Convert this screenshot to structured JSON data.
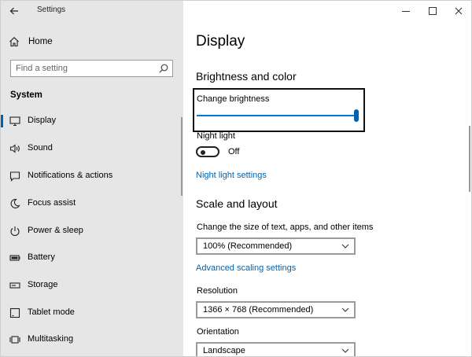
{
  "window": {
    "title": "Settings",
    "back_icon": "back-arrow-icon",
    "controls": [
      "minimize-icon",
      "maximize-icon",
      "close-icon"
    ]
  },
  "sidebar": {
    "home_label": "Home",
    "search_placeholder": "Find a setting",
    "section_label": "System",
    "items": [
      {
        "label": "Display",
        "icon": "display-icon",
        "selected": true
      },
      {
        "label": "Sound",
        "icon": "sound-icon",
        "selected": false
      },
      {
        "label": "Notifications & actions",
        "icon": "notifications-icon",
        "selected": false
      },
      {
        "label": "Focus assist",
        "icon": "moon-icon",
        "selected": false
      },
      {
        "label": "Power & sleep",
        "icon": "power-icon",
        "selected": false
      },
      {
        "label": "Battery",
        "icon": "battery-icon",
        "selected": false
      },
      {
        "label": "Storage",
        "icon": "storage-icon",
        "selected": false
      },
      {
        "label": "Tablet mode",
        "icon": "tablet-icon",
        "selected": false
      },
      {
        "label": "Multitasking",
        "icon": "multitasking-icon",
        "selected": false
      }
    ]
  },
  "content": {
    "page_title": "Display",
    "brightness_section": {
      "heading": "Brightness and color",
      "brightness_label": "Change brightness",
      "brightness_value": 1.0,
      "night_light_label": "Night light",
      "night_light_state": "Off",
      "night_light_link": "Night light settings"
    },
    "scale_section": {
      "heading": "Scale and layout",
      "size_label": "Change the size of text, apps, and other items",
      "size_value": "100% (Recommended)",
      "advanced_link": "Advanced scaling settings",
      "resolution_label": "Resolution",
      "resolution_value": "1366 × 768 (Recommended)",
      "orientation_label": "Orientation",
      "orientation_value": "Landscape"
    }
  },
  "colors": {
    "accent": "#0078d7",
    "link": "#0063b1",
    "sidebar_bg": "#e6e6e6"
  }
}
